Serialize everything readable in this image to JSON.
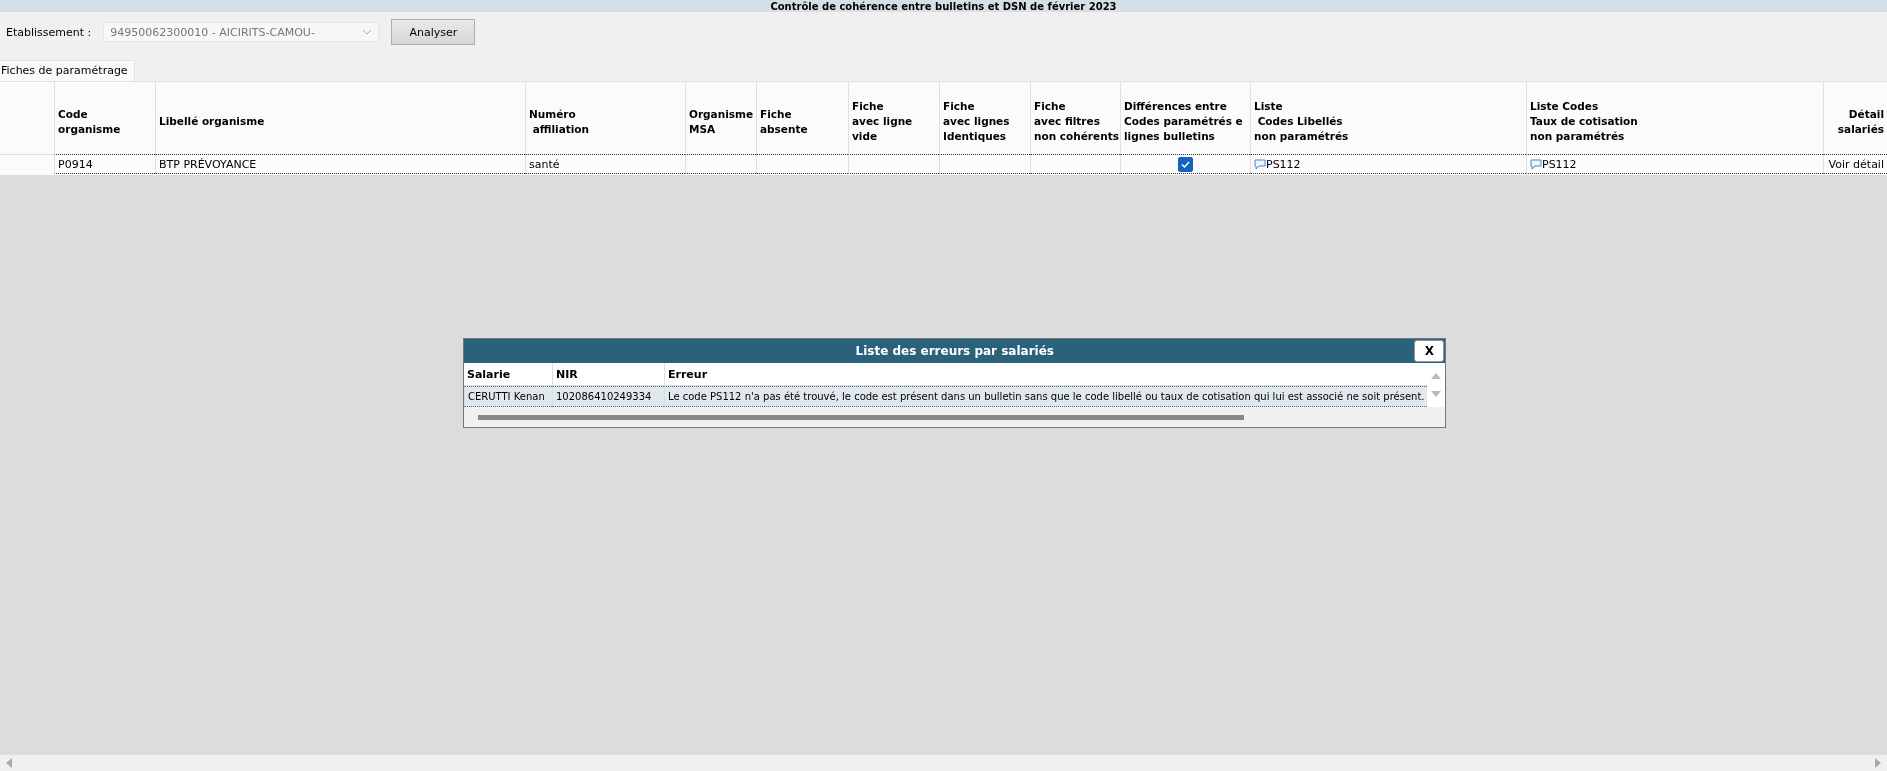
{
  "window": {
    "title": "Contrôle de cohérence entre bulletins et DSN de février 2023"
  },
  "establishment": {
    "label": "Etablissement :",
    "value": "94950062300010 - AICIRITS-CAMOU-",
    "disabled": true
  },
  "analyze_button": "Analyser",
  "tabs": [
    {
      "label": "Fiches de paramétrage",
      "selected": true
    }
  ],
  "table": {
    "columns": [
      {
        "lines": [
          "Code",
          "organisme"
        ]
      },
      {
        "lines": [
          "Libellé organisme"
        ]
      },
      {
        "lines": [
          "Numéro",
          " affiliation"
        ]
      },
      {
        "lines": [
          "Organisme",
          "MSA"
        ]
      },
      {
        "lines": [
          "Fiche",
          "absente"
        ]
      },
      {
        "lines": [
          "Fiche",
          "avec ligne",
          "vide"
        ]
      },
      {
        "lines": [
          "Fiche",
          "avec lignes",
          "Identiques"
        ]
      },
      {
        "lines": [
          "Fiche",
          "avec filtres",
          "non cohérents"
        ]
      },
      {
        "lines": [
          "Différences entre",
          "Codes paramétrés e",
          "lignes bulletins"
        ]
      },
      {
        "lines": [
          "Liste",
          " Codes Libellés",
          "non paramétrés"
        ]
      },
      {
        "lines": [
          "Liste Codes",
          "Taux de cotisation",
          "non paramétrés"
        ]
      },
      {
        "lines": [
          "Détail",
          "salariés"
        ]
      }
    ],
    "rows": [
      {
        "focused": true,
        "cells": [
          {
            "kind": "text",
            "text": "P0914"
          },
          {
            "kind": "text",
            "text": "BTP PRÉVOYANCE"
          },
          {
            "kind": "text",
            "text": "santé"
          },
          {
            "kind": "empty"
          },
          {
            "kind": "empty"
          },
          {
            "kind": "empty"
          },
          {
            "kind": "empty"
          },
          {
            "kind": "empty"
          },
          {
            "kind": "checkbox",
            "checked": true
          },
          {
            "kind": "comment",
            "text": "PS112"
          },
          {
            "kind": "comment",
            "text": "PS112"
          },
          {
            "kind": "link",
            "text": "Voir détail"
          }
        ]
      }
    ]
  },
  "dialog": {
    "title": "Liste des erreurs par salariés",
    "close": "X",
    "columns": [
      "Salarie",
      "NIR",
      "Erreur"
    ],
    "rows": [
      {
        "selected": true,
        "cells": [
          "CERUTTI Kenan",
          "102086410249334",
          "Le code PS112 n'a pas été trouvé, le code est présent dans un bulletin sans que le code libellé ou taux de cotisation qui lui est associé ne soit présent."
        ]
      }
    ]
  }
}
